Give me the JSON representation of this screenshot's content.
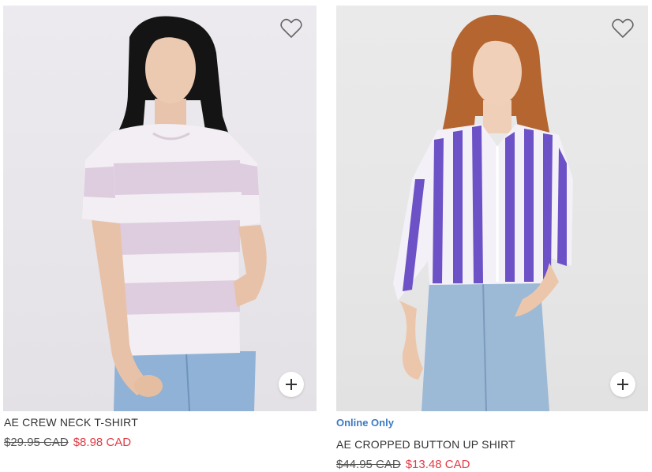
{
  "products": [
    {
      "name": "AE CREW NECK T-SHIRT",
      "badge": "",
      "original_price": "$29.95 CAD",
      "sale_price": "$8.98 CAD",
      "image": "model-in-lilac-striped-t-shirt",
      "favorite_icon": "heart-outline-icon",
      "quick_add_icon": "plus-icon"
    },
    {
      "name": "AE CROPPED BUTTON UP SHIRT",
      "badge": "Online Only",
      "original_price": "$44.95 CAD",
      "sale_price": "$13.48 CAD",
      "image": "model-in-purple-striped-button-up-shirt",
      "favorite_icon": "heart-outline-icon",
      "quick_add_icon": "plus-icon"
    }
  ],
  "colors": {
    "sale": "#e23b45",
    "badge": "#3d7bc1",
    "text": "#333333"
  }
}
